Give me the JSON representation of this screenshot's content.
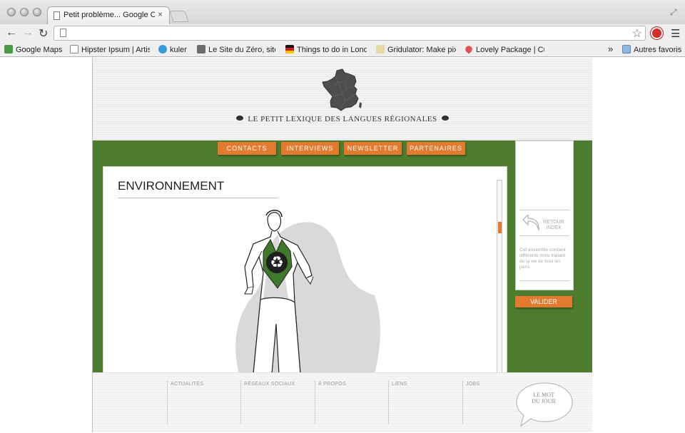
{
  "browser": {
    "tab_title": "Petit problème... Google Chr",
    "tab_close": "×",
    "bookmarks": [
      {
        "label": "Google Maps",
        "color": "#4b9a43"
      },
      {
        "label": "Hipster Ipsum | Artis",
        "color": "#ffffff"
      },
      {
        "label": "kuler",
        "color": "#3b9ad9"
      },
      {
        "label": "Le Site du Zéro, site",
        "color": "#6b6b6b"
      },
      {
        "label": "Things to do in Lond",
        "color": "#cc1f1f"
      },
      {
        "label": "Gridulator: Make pix",
        "color": "#e7d9a6"
      },
      {
        "label": "Lovely Package | Cur",
        "color": "#e0514f"
      }
    ],
    "bookmarks_overflow": "»",
    "other_bookmarks": "Autres favoris"
  },
  "site": {
    "title": "LE  PETIT LEXIQUE DES LANGUES RÉGIONALES",
    "nav": [
      "CONTACTS",
      "INTERVIEWS",
      "NEWSLETTER",
      "PARTENAIRES"
    ],
    "section_title": "ENVIRONNEMENT",
    "side": {
      "back_label": "RETOUR INDEX",
      "description": "Cet ensemble contient différents mots traitant de la vie de tous les jours."
    },
    "valider": "VALIDER",
    "footer": [
      "ACTUALITÉS",
      "RÉSEAUX  SOCIAUX",
      "À PROPOS",
      "LIENS",
      "JOBS"
    ],
    "word_of_day": "LE MOT DU JOUR"
  },
  "colors": {
    "green": "#4e7c2e",
    "orange": "#e37a2d"
  }
}
